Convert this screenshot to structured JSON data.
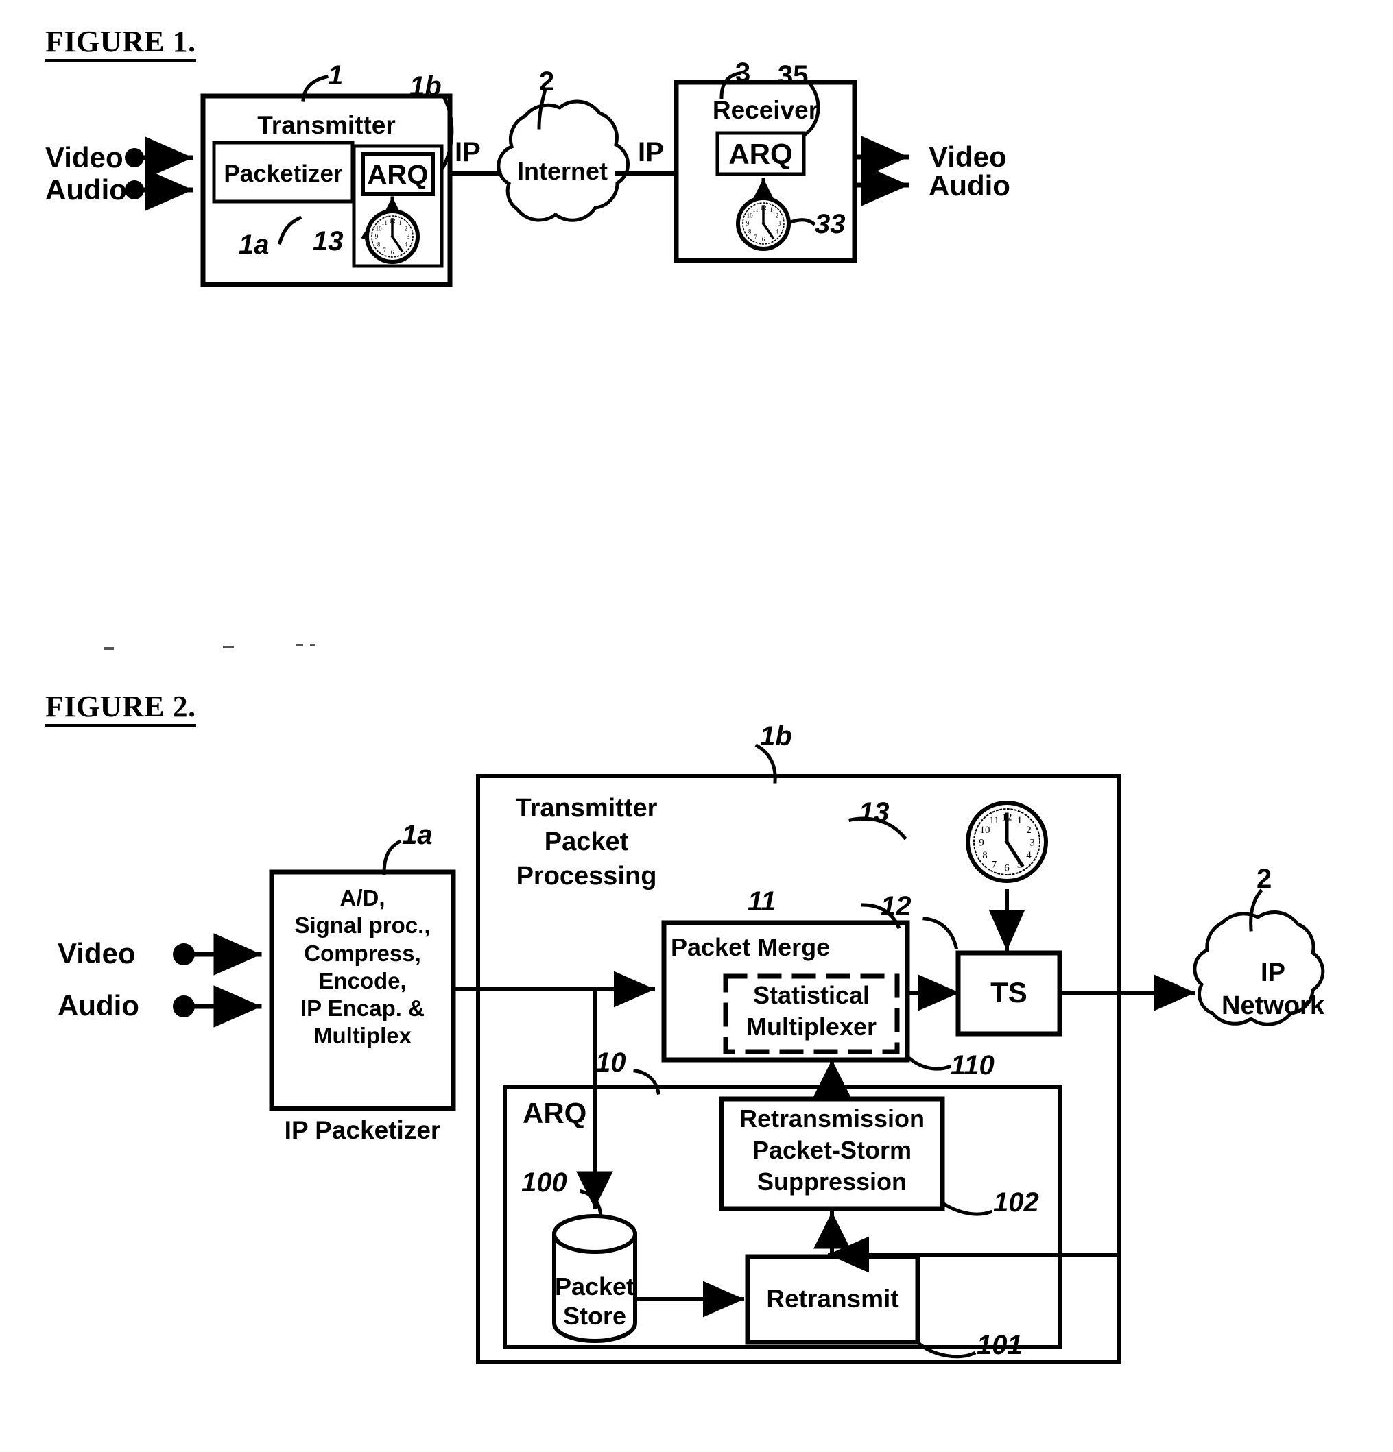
{
  "figures": [
    {
      "title": "FIGURE 1.",
      "inputs": [
        {
          "label": "Video"
        },
        {
          "label": "Audio"
        }
      ],
      "outputs": [
        {
          "label": "Video"
        },
        {
          "label": "Audio"
        }
      ],
      "blocks": {
        "transmitter": "Transmitter",
        "packetizer": "Packetizer",
        "arq_tx": "ARQ",
        "internet": "Internet",
        "receiver": "Receiver",
        "arq_rx": "ARQ"
      },
      "link_labels": {
        "ip_left": "IP",
        "ip_right": "IP"
      },
      "refs": {
        "transmitter": "1",
        "packetizer": "1a",
        "packet_processing": "1b",
        "clock_tx": "13",
        "internet": "2",
        "receiver": "3",
        "arq_rx": "35",
        "clock_rx": "33"
      }
    },
    {
      "title": "FIGURE 2.",
      "inputs": [
        {
          "label": "Video"
        },
        {
          "label": "Audio"
        }
      ],
      "blocks": {
        "packetizer_body": "A/D,\nSignal proc.,\nCompress,\nEncode,\nIP Encap. &\nMultiplex",
        "packetizer_caption": "IP Packetizer",
        "transmitter_packet_processing": "Transmitter\nPacket\nProcessing",
        "packet_merge": "Packet Merge",
        "statistical_multiplexer": "Statistical\nMultiplexer",
        "ts": "TS",
        "arq": "ARQ",
        "retransmission_suppression": "Retransmission\nPacket-Storm\nSuppression",
        "packet_store": "Packet\nStore",
        "retransmit": "Retransmit",
        "ip_network": "IP\nNetwork"
      },
      "refs": {
        "packet_processing": "1b",
        "packetizer": "1a",
        "clock": "13",
        "packet_merge": "11",
        "ts": "12",
        "statistical_multiplexer": "110",
        "arq": "10",
        "packet_store": "100",
        "retransmit": "101",
        "suppression": "102",
        "ip_network": "2"
      }
    }
  ],
  "clock_faces": {
    "hour_numbers": [
      "12",
      "1",
      "2",
      "3",
      "4",
      "5",
      "6",
      "7",
      "8",
      "9",
      "10",
      "11"
    ],
    "hands": {
      "minute_deg": 0,
      "hour_deg": 150
    }
  },
  "colors": {
    "ink": "#000000",
    "paper": "#ffffff"
  }
}
